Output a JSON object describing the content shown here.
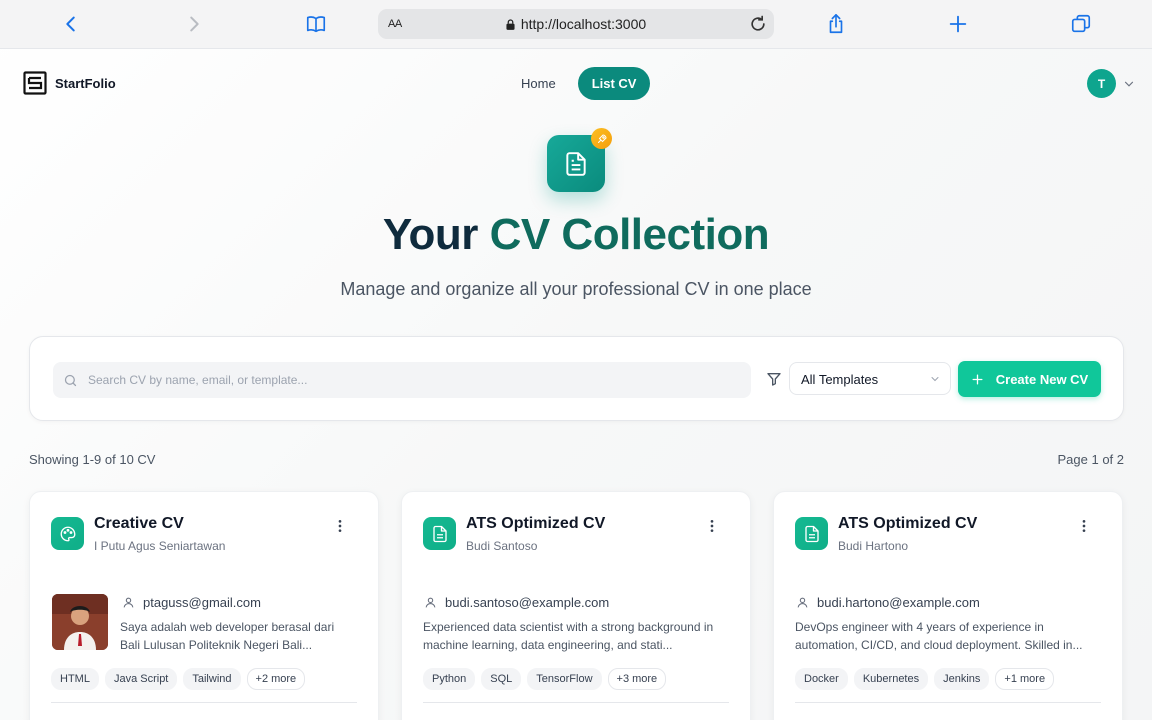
{
  "browser": {
    "text_size_label": "AA",
    "url": "http://localhost:3000"
  },
  "app": {
    "brand": "StartFolio",
    "nav": [
      {
        "label": "Home",
        "active": false
      },
      {
        "label": "List CV",
        "active": true
      }
    ],
    "user_initial": "T"
  },
  "hero": {
    "title_part1": "Your ",
    "title_part2": "CV Collection",
    "subtitle": "Manage and organize all your professional CV in one place"
  },
  "toolbar": {
    "search_placeholder": "Search CV by name, email, or template...",
    "template_filter": "All Templates",
    "create_label": "Create New CV"
  },
  "listing": {
    "showing": "Showing 1-9 of 10 CV",
    "page": "Page 1 of 2"
  },
  "cards": [
    {
      "title": "Creative CV",
      "owner": "I Putu Agus Seniartawan",
      "icon": "palette-icon",
      "email": "ptaguss@gmail.com",
      "description_line1": "Saya adalah web developer berasal dari",
      "description_line2": "Bali Lulusan Politeknik Negeri Bali...",
      "tags": [
        "HTML",
        "Java Script",
        "Tailwind"
      ],
      "more": "+2 more",
      "has_photo": true
    },
    {
      "title": "ATS Optimized CV",
      "owner": "Budi Santoso",
      "icon": "document-icon",
      "email": "budi.santoso@example.com",
      "description_line1": "Experienced data scientist with a strong background in",
      "description_line2": "machine learning, data engineering, and stati...",
      "tags": [
        "Python",
        "SQL",
        "TensorFlow"
      ],
      "more": "+3 more",
      "has_photo": false
    },
    {
      "title": "ATS Optimized CV",
      "owner": "Budi Hartono",
      "icon": "document-icon",
      "email": "budi.hartono@example.com",
      "description_line1": "DevOps engineer with 4 years of experience in",
      "description_line2": "automation, CI/CD, and cloud deployment. Skilled in...",
      "tags": [
        "Docker",
        "Kubernetes",
        "Jenkins"
      ],
      "more": "+1 more",
      "has_photo": false
    }
  ],
  "colors": {
    "brand_teal": "#0b8a7d",
    "accent_green": "#10c79a",
    "title_dark": "#0f2b3d",
    "title_teal": "#0f6b5d"
  }
}
